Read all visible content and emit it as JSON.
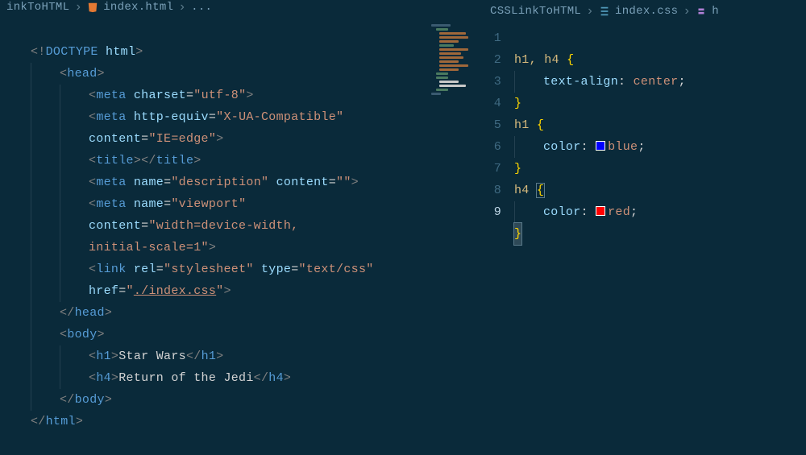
{
  "left": {
    "breadcrumb": {
      "folder": "inkToHTML",
      "file": "index.html",
      "more": "..."
    },
    "code": {
      "doctype": "<!DOCTYPE html>",
      "l2": {
        "tag": "head"
      },
      "l3": {
        "tag": "meta",
        "attrs": " charset=\"utf-8\""
      },
      "l4a": {
        "tag": "meta",
        "attrs": " http-equiv=\"X-UA-Compatible\""
      },
      "l5": {
        "attrs": "content=\"IE=edge\""
      },
      "l6": {
        "open": "<title>",
        "close": "</title>"
      },
      "l7": {
        "tag": "meta",
        "attrs": " name=\"description\" content=\"\""
      },
      "l8": {
        "tag": "meta",
        "attrs": " name=\"viewport\""
      },
      "l9": {
        "attrs": "content=\"width=device-width,"
      },
      "l10": {
        "attrs": "initial-scale=1\""
      },
      "l11": {
        "tag": "link",
        "attrs": " rel=\"stylesheet\" type=\"text/css\""
      },
      "l12_pre": "href=",
      "l12_q": "\"",
      "l12_href": "./index.css",
      "l12_rest": ">",
      "l13": {
        "close": "head"
      },
      "l14": {
        "open": "body"
      },
      "l15_open": "<h1>",
      "l15_text": "Star Wars",
      "l15_close": "</h1>",
      "l16_open": "<h4>",
      "l16_text": "Return of the Jedi",
      "l16_close": "</h4>",
      "l17": {
        "close": "body"
      },
      "l18": "</html>"
    }
  },
  "right": {
    "breadcrumb": {
      "folder": "CSSLinkToHTML",
      "file": "index.css",
      "symbol": "h"
    },
    "gutter": [
      "1",
      "2",
      "3",
      "4",
      "5",
      "6",
      "7",
      "8",
      "9"
    ],
    "code": {
      "l1_sel": "h1, h4 ",
      "l1_brace": "{",
      "l2_prop": "text-align",
      "l2_val": "center",
      "l3": "}",
      "l4_sel": "h1 ",
      "l4_brace": "{",
      "l5_prop": "color",
      "l5_val": "blue",
      "l6": "}",
      "l7_sel": "h4 ",
      "l7_brace": "{",
      "l8_prop": "color",
      "l8_val": "red",
      "l9": "}"
    }
  }
}
